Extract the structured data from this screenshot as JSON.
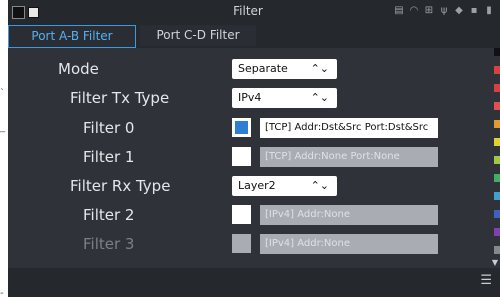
{
  "window": {
    "title": "Filter"
  },
  "status": {
    "left_icons": [
      "black-square-icon",
      "white-square-icon"
    ],
    "right_icons": [
      "device-icon",
      "wifi-icon",
      "network-icon",
      "usb-icon",
      "tool-icon",
      "save-icon",
      "plug-icon"
    ]
  },
  "tabs": [
    {
      "label": "Port A-B Filter",
      "active": true
    },
    {
      "label": "Port C-D Filter",
      "active": false
    }
  ],
  "colors": {
    "accent": "#3b9ae0",
    "checkbox_checked": "#2d7fd3",
    "right_strip": [
      "#111111",
      "#d94040",
      "#d94040",
      "#e05050",
      "#e09a30",
      "#e0d030",
      "#a0c840",
      "#40b060",
      "#40a0d0",
      "#4060c0",
      "#8040b0",
      "#d060c0",
      "#888888"
    ]
  },
  "form": {
    "mode": {
      "label": "Mode",
      "value": "Separate"
    },
    "filter_tx_type": {
      "label": "Filter Tx Type",
      "value": "IPv4"
    },
    "filter0": {
      "label": "Filter 0",
      "checked": true,
      "value": "[TCP] Addr:Dst&Src Port:Dst&Src"
    },
    "filter1": {
      "label": "Filter 1",
      "checked": false,
      "value": "[TCP] Addr:None Port:None"
    },
    "filter_rx_type": {
      "label": "Filter Rx Type",
      "value": "Layer2"
    },
    "filter2": {
      "label": "Filter 2",
      "checked": false,
      "value": "[IPv4] Addr:None"
    },
    "filter3": {
      "label": "Filter 3",
      "checked": false,
      "value": "[IPv4] Addr:None"
    }
  },
  "icons": {
    "menu": "menu-icon",
    "select_chevron": "chevron-updown-icon"
  },
  "outside_marks": [
    "`",
    "_",
    "-"
  ]
}
